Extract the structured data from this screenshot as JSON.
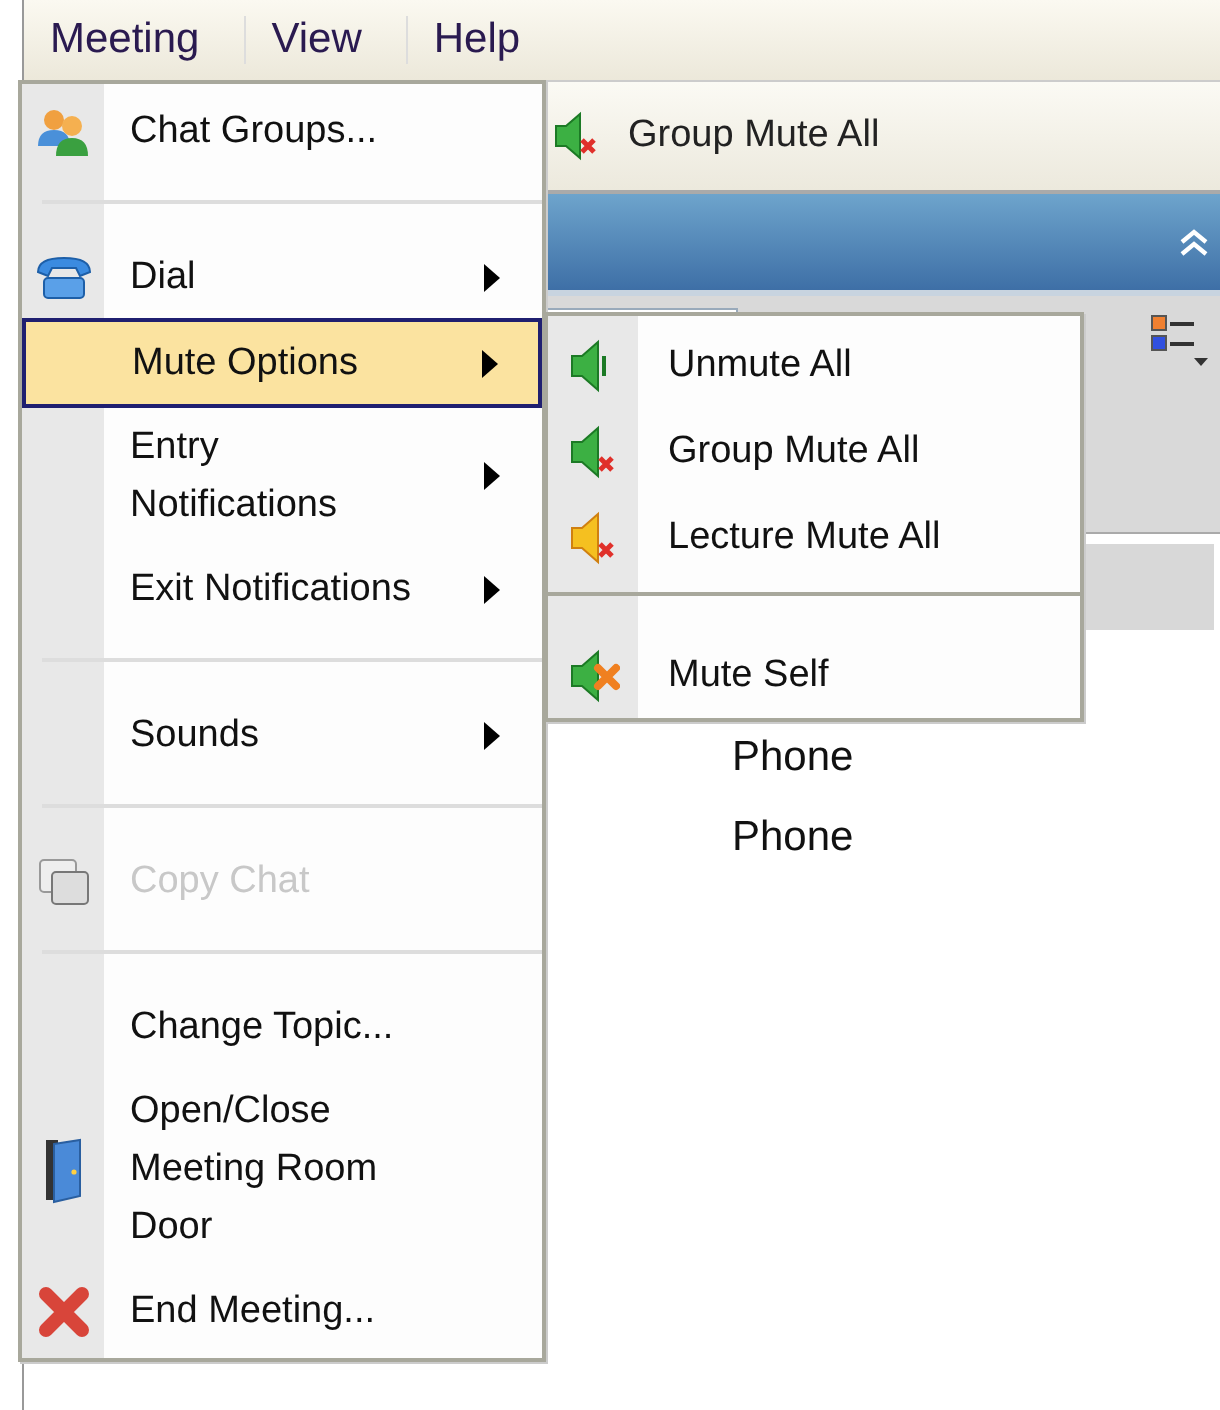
{
  "menu_bar": [
    {
      "label": "Meeting"
    },
    {
      "label": "View"
    },
    {
      "label": "Help"
    }
  ],
  "toolbar": {
    "button": "Group Mute All"
  },
  "content": {
    "rows": [
      "Phone",
      "Phone"
    ]
  },
  "meeting_menu": {
    "items": [
      {
        "kind": "item",
        "label": "Chat Groups...",
        "selected": false,
        "disabled": false,
        "submenu": false
      },
      {
        "kind": "separator"
      },
      {
        "kind": "item",
        "label": "Dial",
        "selected": false,
        "disabled": false,
        "submenu": true
      },
      {
        "kind": "item",
        "label": "Mute Options",
        "selected": true,
        "disabled": false,
        "submenu": true
      },
      {
        "kind": "item",
        "label": "Entry\nNotifications",
        "selected": false,
        "disabled": false,
        "submenu": true
      },
      {
        "kind": "item",
        "label": "Exit Notifications",
        "selected": false,
        "disabled": false,
        "submenu": true
      },
      {
        "kind": "separator"
      },
      {
        "kind": "item",
        "label": "Sounds",
        "selected": false,
        "disabled": false,
        "submenu": true
      },
      {
        "kind": "separator"
      },
      {
        "kind": "item",
        "label": "Copy Chat",
        "selected": false,
        "disabled": true,
        "submenu": false
      },
      {
        "kind": "separator"
      },
      {
        "kind": "item",
        "label": "Change Topic...",
        "selected": false,
        "disabled": false,
        "submenu": false
      },
      {
        "kind": "item",
        "label": "Open/Close\nMeeting Room\nDoor",
        "selected": false,
        "disabled": false,
        "submenu": false
      },
      {
        "kind": "item",
        "label": "End Meeting...",
        "selected": false,
        "disabled": false,
        "submenu": false
      }
    ]
  },
  "mute_options_menu": {
    "items": [
      {
        "kind": "item",
        "label": "Unmute All"
      },
      {
        "kind": "item",
        "label": "Group Mute All"
      },
      {
        "kind": "item",
        "label": "Lecture Mute All"
      },
      {
        "kind": "separator"
      },
      {
        "kind": "item",
        "label": "Mute Self"
      }
    ]
  }
}
